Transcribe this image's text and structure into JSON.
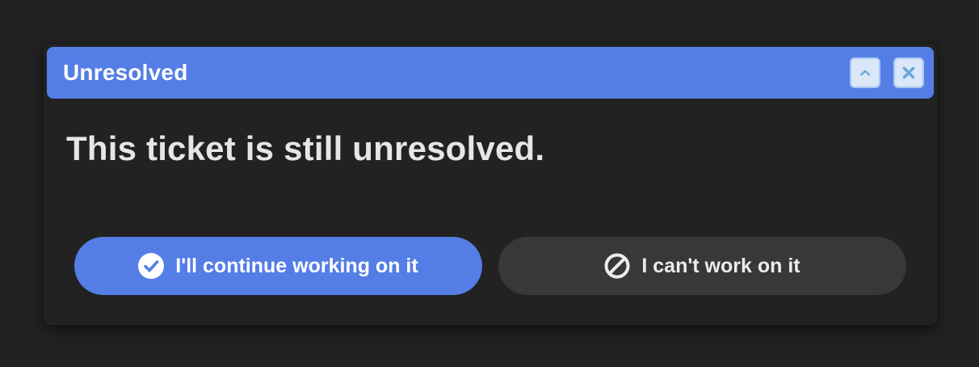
{
  "dialog": {
    "title": "Unresolved",
    "message": "This ticket is still unresolved.",
    "collapse_icon": "chevron-up-icon",
    "close_icon": "close-icon"
  },
  "actions": {
    "continue_label": "I'll continue working on it",
    "continue_icon": "check-circle-icon",
    "cant_work_label": "I can't work on it",
    "cant_work_icon": "prohibited-icon"
  },
  "colors": {
    "background": "#222222",
    "accent": "#547ee6",
    "secondary_button": "#383838",
    "message_text": "#e6e6e6",
    "titlebar_button_bg": "#d9e7f8",
    "titlebar_button_icon": "#6aa8dc"
  }
}
